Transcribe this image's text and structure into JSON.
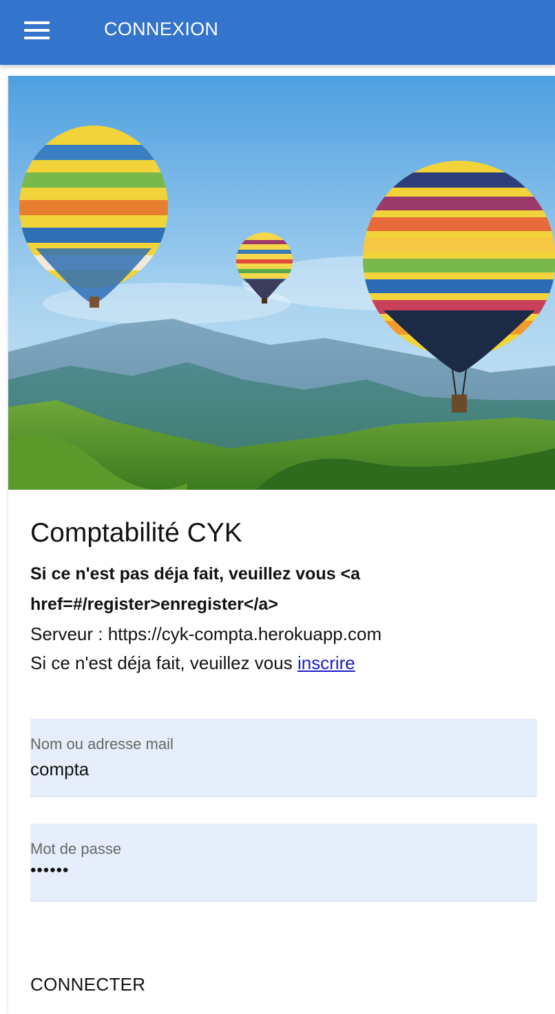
{
  "theme": {
    "accent": "#3474cc",
    "link": "#1a1acb",
    "field_bg": "#e7eefb"
  },
  "appbar": {
    "menu_icon": "hamburger-menu-icon",
    "title": "CONNEXION"
  },
  "hero": {
    "image": "hot-air-balloons-over-mountains"
  },
  "main": {
    "title": "Comptabilité CYK",
    "subtitle": "Si ce n'est pas déja fait, veuillez vous <a href=#/register>enregister</a>",
    "server_text": "Serveur : https://cyk-compta.herokuapp.com",
    "register_prefix": "Si ce n'est déja fait, veuillez vous ",
    "register_link": "inscrire"
  },
  "form": {
    "username": {
      "label": "Nom ou adresse mail",
      "value": "compta"
    },
    "password": {
      "label": "Mot de passe",
      "value": "••••••"
    },
    "submit_label": "CONNECTER"
  }
}
